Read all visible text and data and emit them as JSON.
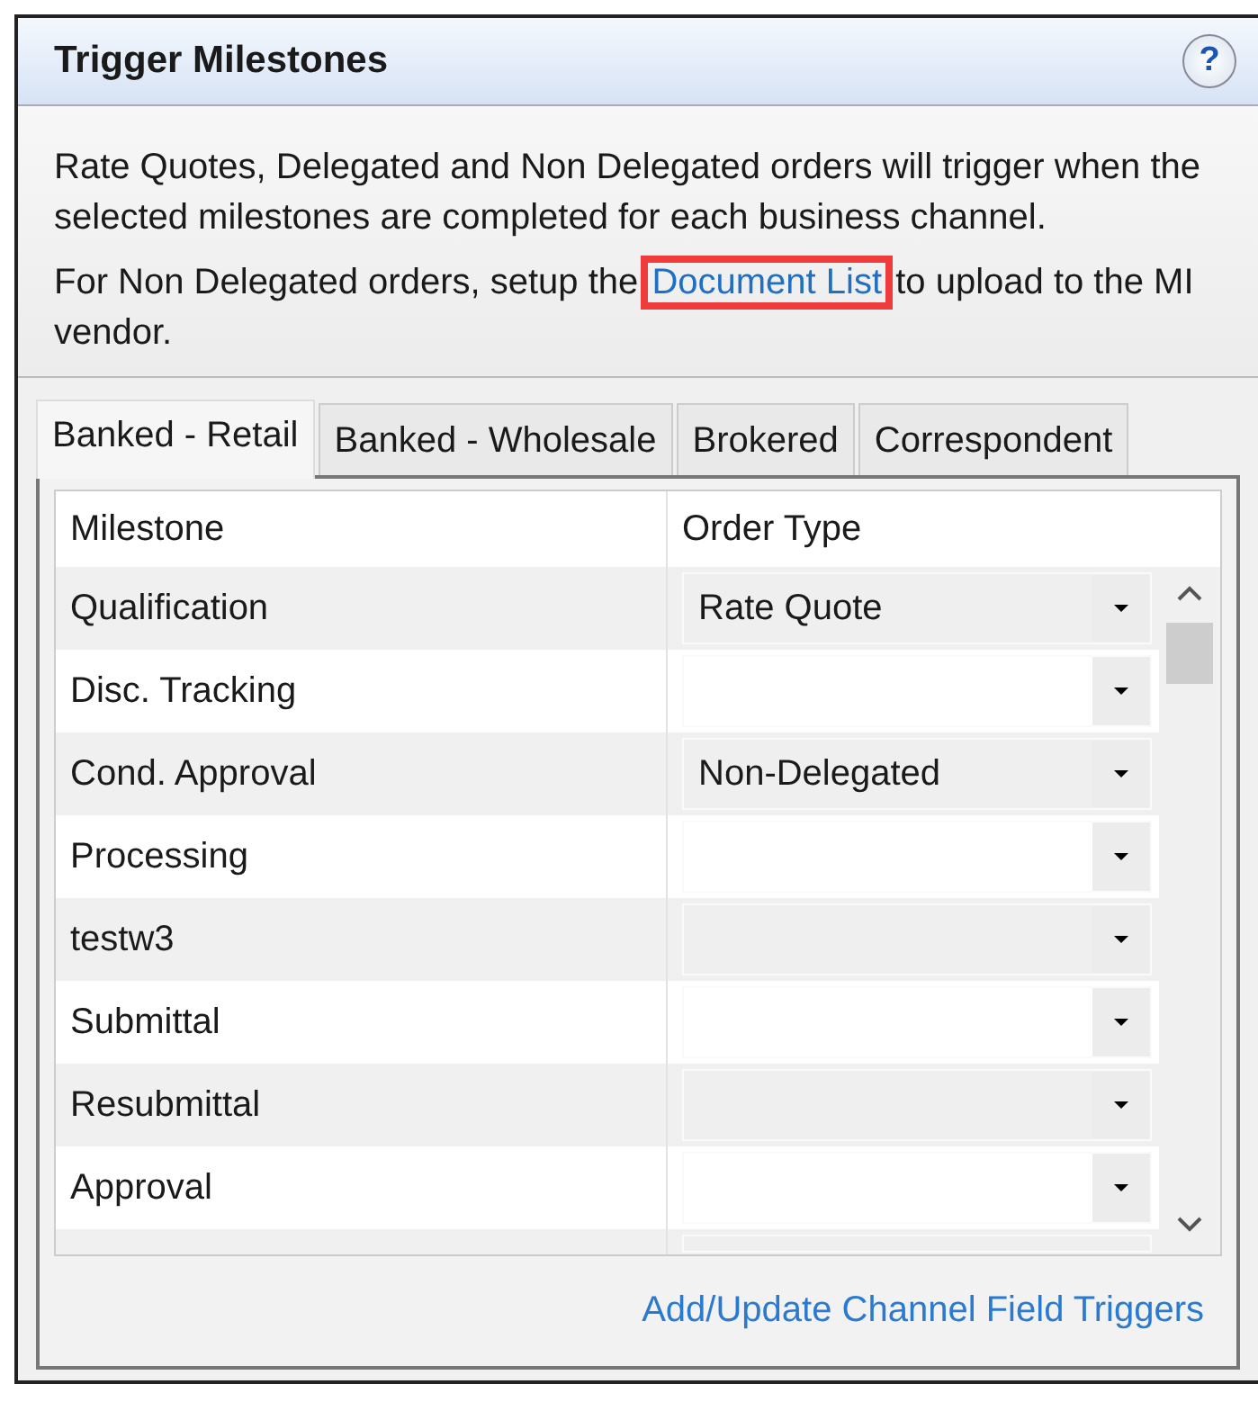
{
  "panel": {
    "title": "Trigger Milestones",
    "help": "?"
  },
  "description": {
    "text": "Rate Quotes, Delegated and Non Delegated orders will trigger when the selected milestones are completed for each business channel.",
    "note_before": "For Non Delegated orders, setup the",
    "link": {
      "label": "Document List",
      "highlighted": true
    },
    "note_after": "to upload to the MI vendor."
  },
  "tabs": [
    {
      "label": "Banked - Retail",
      "selected": true
    },
    {
      "label": "Banked - Wholesale",
      "selected": false
    },
    {
      "label": "Brokered",
      "selected": false
    },
    {
      "label": "Correspondent",
      "selected": false
    }
  ],
  "table": {
    "columns": [
      "Milestone",
      "Order Type"
    ],
    "rows": [
      {
        "milestone": "Qualification",
        "order_type": "Rate Quote"
      },
      {
        "milestone": "Disc. Tracking",
        "order_type": ""
      },
      {
        "milestone": "Cond. Approval",
        "order_type": "Non-Delegated"
      },
      {
        "milestone": "Processing",
        "order_type": ""
      },
      {
        "milestone": "testw3",
        "order_type": ""
      },
      {
        "milestone": "Submittal",
        "order_type": ""
      },
      {
        "milestone": "Resubmittal",
        "order_type": ""
      },
      {
        "milestone": "Approval",
        "order_type": ""
      }
    ]
  },
  "footer_link": "Add/Update Channel Field Triggers"
}
